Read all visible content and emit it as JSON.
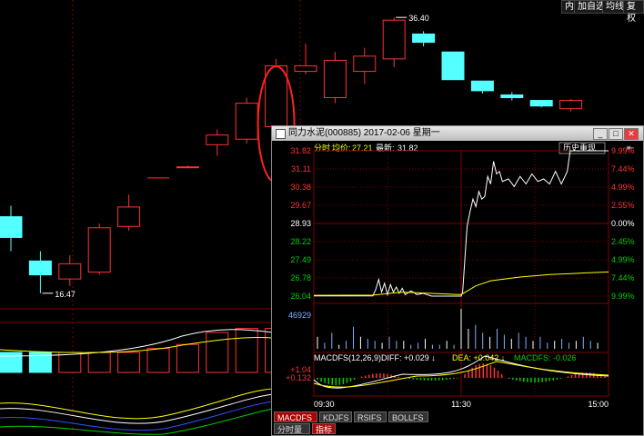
{
  "top_buttons": [
    "内",
    "加自选",
    "均线",
    "复权"
  ],
  "main_chart": {
    "type": "candlestick",
    "max_label": "36.40",
    "min_label": "16.47",
    "candles": [
      {
        "o": 22.0,
        "h": 22.8,
        "l": 19.5,
        "c": 20.5
      },
      {
        "o": 18.8,
        "h": 19.5,
        "l": 16.47,
        "c": 17.8
      },
      {
        "o": 17.5,
        "h": 19.2,
        "l": 17.0,
        "c": 18.6
      },
      {
        "o": 18.0,
        "h": 21.5,
        "l": 17.8,
        "c": 21.2
      },
      {
        "o": 21.3,
        "h": 23.6,
        "l": 21.0,
        "c": 22.7
      },
      {
        "o": null,
        "h": null,
        "l": null,
        "c": null
      },
      {
        "o": 25.6,
        "h": 25.7,
        "l": 25.5,
        "c": 25.6
      },
      {
        "o": 27.2,
        "h": 28.3,
        "l": 26.4,
        "c": 27.9
      },
      {
        "o": 27.6,
        "h": 30.6,
        "l": 27.3,
        "c": 30.2
      },
      {
        "o": 28.5,
        "h": 33.4,
        "l": 27.9,
        "c": 32.9
      },
      {
        "o": 32.5,
        "h": 34.5,
        "l": 32.3,
        "c": 32.9
      },
      {
        "o": 30.6,
        "h": 33.9,
        "l": 30.2,
        "c": 33.3
      },
      {
        "o": 32.5,
        "h": 34.2,
        "l": 31.6,
        "c": 33.6
      },
      {
        "o": 33.4,
        "h": 36.4,
        "l": 32.8,
        "c": 36.2
      },
      {
        "o": 35.2,
        "h": 35.4,
        "l": 34.3,
        "c": 34.6
      },
      {
        "o": 33.9,
        "h": 33.9,
        "l": 31.9,
        "c": 31.9
      },
      {
        "o": 31.8,
        "h": 31.8,
        "l": 30.9,
        "c": 31.1
      },
      {
        "o": 30.8,
        "h": 31.0,
        "l": 30.4,
        "c": 30.6
      },
      {
        "o": 30.4,
        "h": 30.4,
        "l": 29.9,
        "c": 30.0
      },
      {
        "o": 29.8,
        "h": 30.5,
        "l": 29.6,
        "c": 30.4
      }
    ],
    "vol_bars": [
      0.25,
      0.25,
      0.25,
      0.25,
      0.25,
      0.3,
      0.35,
      0.5,
      0.55,
      0.55,
      0.55,
      0.5,
      0.5,
      0.5,
      0.4,
      0.35,
      0.3,
      0.3,
      0.3,
      0.3
    ]
  },
  "popup": {
    "title": "同力水泥(000885) 2017-02-06 星期一",
    "info_label": "分时",
    "avg_label": "均价:",
    "avg_value": "27.21",
    "latest_label": "最新:",
    "latest_value": "31.82",
    "replay_button": "历史重现",
    "price_labels": [
      "31.82",
      "31.11",
      "30.38",
      "29.67",
      "28.93",
      "28.22",
      "27.49",
      "26.78",
      "26.04"
    ],
    "pct_labels": [
      "9.99%",
      "7.44%",
      "4.99%",
      "2.55%",
      "0.00%",
      "2.45%",
      "4.99%",
      "7.44%",
      "9.99%"
    ],
    "price_range": [
      26.04,
      31.82
    ],
    "prev_close": 28.93,
    "volume_label": "46929",
    "macd_header": "MACDFS(12,26,9)",
    "diff_label": "DIFF: +0.029",
    "dea_label": "DEA: +0.042",
    "macdfs_label": "MACDFS: -0.026",
    "macd_axis": [
      "+1.04",
      "+0.132"
    ],
    "time_labels": [
      "09:30",
      "11:30",
      "15:00"
    ],
    "indicator_tabs": [
      "MACDFS",
      "KDJFS",
      "RSIFS",
      "BOLLFS"
    ],
    "bottom_tabs": [
      "分时量",
      "指标"
    ]
  },
  "colors": {
    "up": "#ff3232",
    "down": "#54ffff",
    "grid": "#800000",
    "yellow": "#ffff00",
    "green": "#00d000",
    "white": "#ffffff"
  }
}
